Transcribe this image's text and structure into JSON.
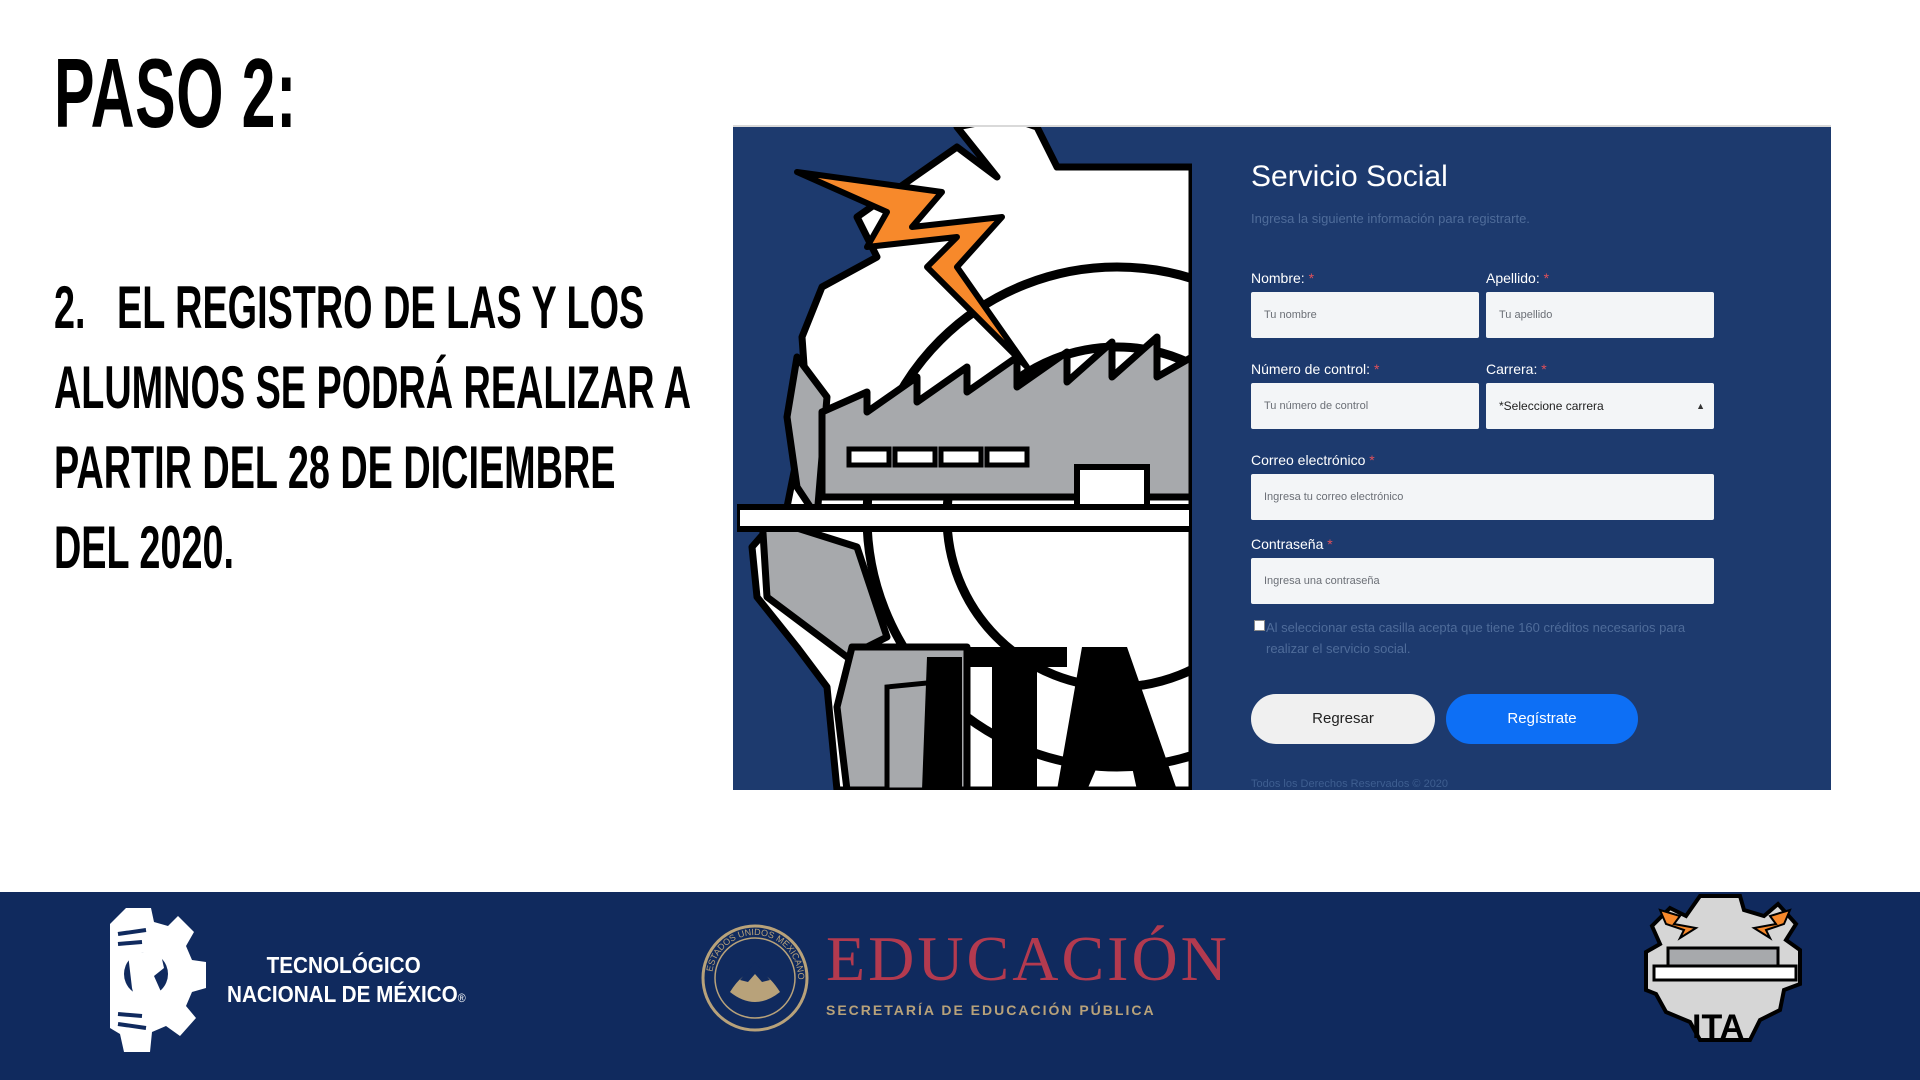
{
  "slide": {
    "title": "PASO 2:",
    "step_number": "2.",
    "step_text": "EL REGISTRO DE LAS Y LOS ALUMNOS SE PODRÁ REALIZAR  A PARTIR DEL 28 DE DICIEMBRE DEL 2020."
  },
  "form": {
    "title": "Servicio Social",
    "subtitle": "Ingresa la siguiente información para registrarte.",
    "required_mark": "*",
    "fields": {
      "nombre": {
        "label": "Nombre:",
        "placeholder": "Tu nombre"
      },
      "apellido": {
        "label": "Apellido:",
        "placeholder": "Tu apellido"
      },
      "numero_control": {
        "label": "Número de control:",
        "placeholder": "Tu número de control"
      },
      "carrera": {
        "label": "Carrera:",
        "selected": "*Seleccione carrera"
      },
      "correo": {
        "label": "Correo electrónico",
        "placeholder": "Ingresa tu correo electrónico"
      },
      "contrasena": {
        "label": "Contraseña",
        "placeholder": "Ingresa una contraseña"
      }
    },
    "checkbox_text": "Al seleccionar esta casilla acepta que tiene 160 créditos necesarios para realizar el servicio social.",
    "buttons": {
      "back": "Regresar",
      "register": "Regístrate"
    },
    "footer_partial": "Todos los Derechos Reservados © 2020"
  },
  "footer": {
    "tecnm_line1": "TECNOLÓGICO",
    "tecnm_line2": "NACIONAL DE MÉXICO",
    "tecnm_mark": "®",
    "seal_text": "ESTADOS UNIDOS MEXICANOS",
    "edu_title": "EDUCACIÓN",
    "edu_subtitle": "SECRETARÍA DE EDUCACIÓN PÚBLICA",
    "ita_logo_text": "ITA"
  },
  "colors": {
    "navy": "#1d3a6e",
    "footer_navy": "#102a5e",
    "accent_blue": "#0d6ff5",
    "bolt_orange": "#f7892b",
    "edu_red": "#b33a4f",
    "edu_gold": "#b8a27a"
  }
}
